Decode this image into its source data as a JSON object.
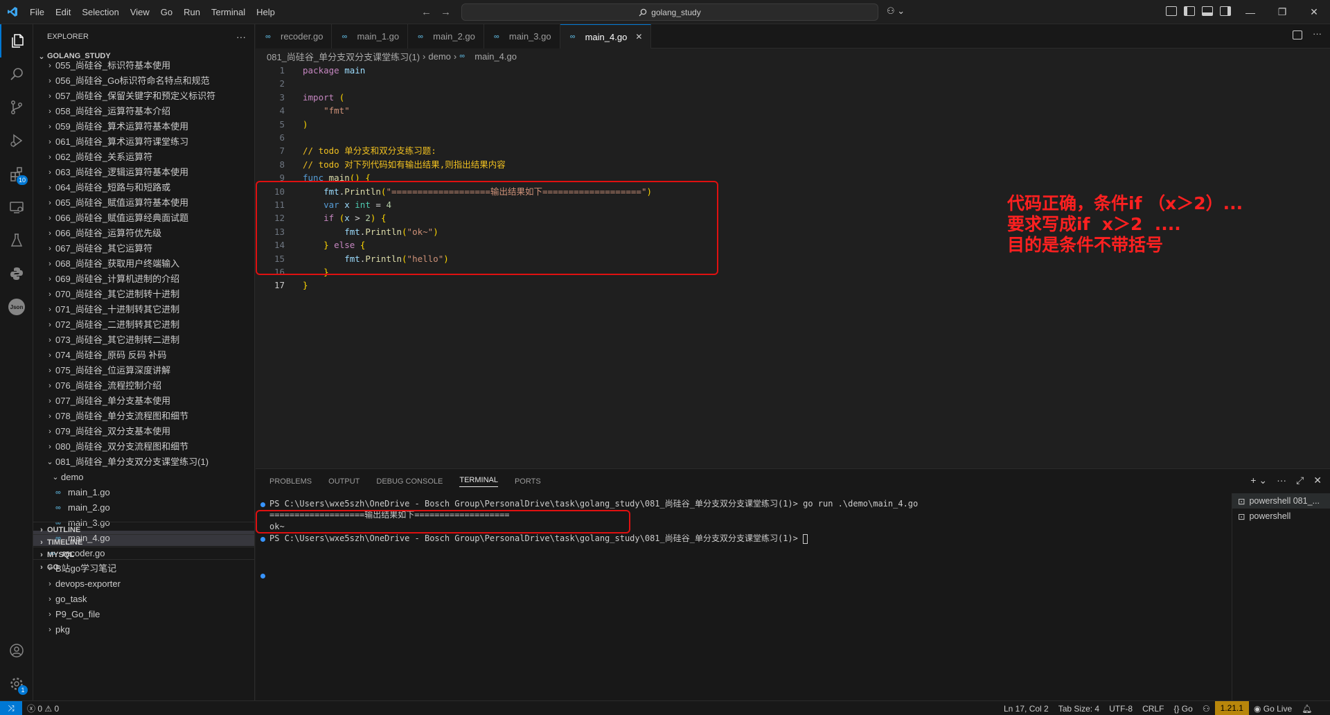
{
  "titlebar": {
    "menu": [
      "File",
      "Edit",
      "Selection",
      "View",
      "Go",
      "Run",
      "Terminal",
      "Help"
    ],
    "search_text": "golang_study"
  },
  "sidebar": {
    "title": "EXPLORER",
    "root": "GOLANG_STUDY",
    "folders": [
      "055_尚硅谷_标识符基本使用",
      "056_尚硅谷_Go标识符命名特点和规范",
      "057_尚硅谷_保留关键字和预定义标识符",
      "058_尚硅谷_运算符基本介绍",
      "059_尚硅谷_算术运算符基本使用",
      "061_尚硅谷_算术运算符课堂练习",
      "062_尚硅谷_关系运算符",
      "063_尚硅谷_逻辑运算符基本使用",
      "064_尚硅谷_短路与和短路或",
      "065_尚硅谷_赋值运算符基本使用",
      "066_尚硅谷_赋值运算经典面试题",
      "066_尚硅谷_运算符优先级",
      "067_尚硅谷_其它运算符",
      "068_尚硅谷_获取用户终端输入",
      "069_尚硅谷_计算机进制的介绍",
      "070_尚硅谷_其它进制转十进制",
      "071_尚硅谷_十进制转其它进制",
      "072_尚硅谷_二进制转其它进制",
      "073_尚硅谷_其它进制转二进制",
      "074_尚硅谷_原码 反码 补码",
      "075_尚硅谷_位运算深度讲解",
      "076_尚硅谷_流程控制介绍",
      "077_尚硅谷_单分支基本使用",
      "078_尚硅谷_单分支流程图和细节",
      "079_尚硅谷_双分支基本使用",
      "080_尚硅谷_双分支流程图和细节"
    ],
    "open_folder": "081_尚硅谷_单分支双分支课堂练习(1)",
    "subfolder": "demo",
    "demo_files": [
      "main_1.go",
      "main_2.go",
      "main_3.go",
      "main_4.go"
    ],
    "recoder_file": "recoder.go",
    "other_folders": [
      "B站go学习笔记",
      "devops-exporter",
      "go_task",
      "P9_Go_file",
      "pkg"
    ],
    "sections": [
      "OUTLINE",
      "TIMELINE",
      "MYSQL",
      "GO"
    ]
  },
  "tabs": [
    "recoder.go",
    "main_1.go",
    "main_2.go",
    "main_3.go",
    "main_4.go"
  ],
  "active_tab": "main_4.go",
  "breadcrumb": [
    "081_尚硅谷_单分支双分支课堂练习(1)",
    "demo",
    "main_4.go"
  ],
  "code_lines": [
    "package main",
    "",
    "import (",
    "    \"fmt\"",
    ")",
    "",
    "// todo 单分支和双分支练习题:",
    "// todo 对下列代码如有输出结果,则指出结果内容",
    "func main() {",
    "    fmt.Println(\"===================输出结果如下===================\")",
    "    var x int = 4",
    "    if (x > 2) {",
    "        fmt.Println(\"ok~\")",
    "    } else {",
    "        fmt.Println(\"hello\")",
    "    }",
    "}"
  ],
  "annotation": [
    "代码正确，条件if （x＞2）...",
    "要求写成if  x＞2  ....",
    "目的是条件不带括号"
  ],
  "panel": {
    "tabs": [
      "PROBLEMS",
      "OUTPUT",
      "DEBUG CONSOLE",
      "TERMINAL",
      "PORTS"
    ],
    "active_tab": "TERMINAL",
    "terminal_lines": [
      "PS C:\\Users\\wxe5szh\\OneDrive - Bosch Group\\PersonalDrive\\task\\golang_study\\081_尚硅谷_单分支双分支课堂练习(1)> go run .\\demo\\main_4.go",
      "===================输出结果如下===================",
      "ok~",
      "PS C:\\Users\\wxe5szh\\OneDrive - Bosch Group\\PersonalDrive\\task\\golang_study\\081_尚硅谷_单分支双分支课堂练习(1)> "
    ],
    "terminals": [
      "powershell 081_...",
      "powershell"
    ]
  },
  "statusbar": {
    "errors": "0",
    "warnings": "0",
    "cursor": "Ln 17, Col 2",
    "tab_size": "Tab Size: 4",
    "encoding": "UTF-8",
    "eol": "CRLF",
    "language": "Go",
    "go_version": "1.21.1",
    "go_live": "Go Live"
  },
  "colors": {
    "accent": "#0078d4",
    "annotation": "#ff2020"
  }
}
